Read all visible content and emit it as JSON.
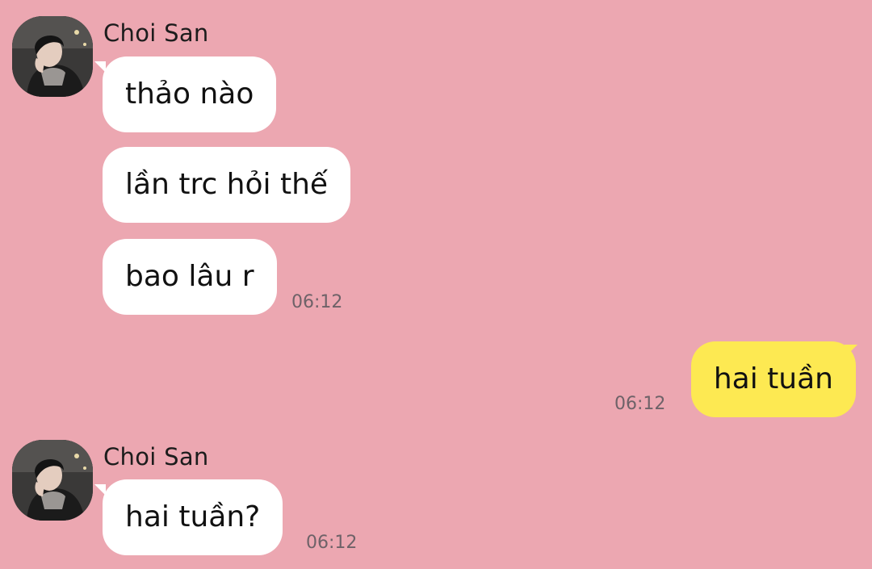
{
  "chat": {
    "group1": {
      "sender": "Choi San",
      "avatar_icon": "profile-photo",
      "messages": [
        {
          "text": "thảo nào"
        },
        {
          "text": "lần trc hỏi thế"
        },
        {
          "text": "bao lâu r"
        }
      ],
      "time": "06:12"
    },
    "outgoing": {
      "text": "hai tuần",
      "time": "06:12"
    },
    "group2": {
      "sender": "Choi San",
      "avatar_icon": "profile-photo",
      "messages": [
        {
          "text": "hai tuần?"
        }
      ],
      "time": "06:12"
    }
  },
  "colors": {
    "background": "#eca7b1",
    "incoming_bubble": "#ffffff",
    "outgoing_bubble": "#fde952",
    "timestamp": "#6e6268"
  }
}
